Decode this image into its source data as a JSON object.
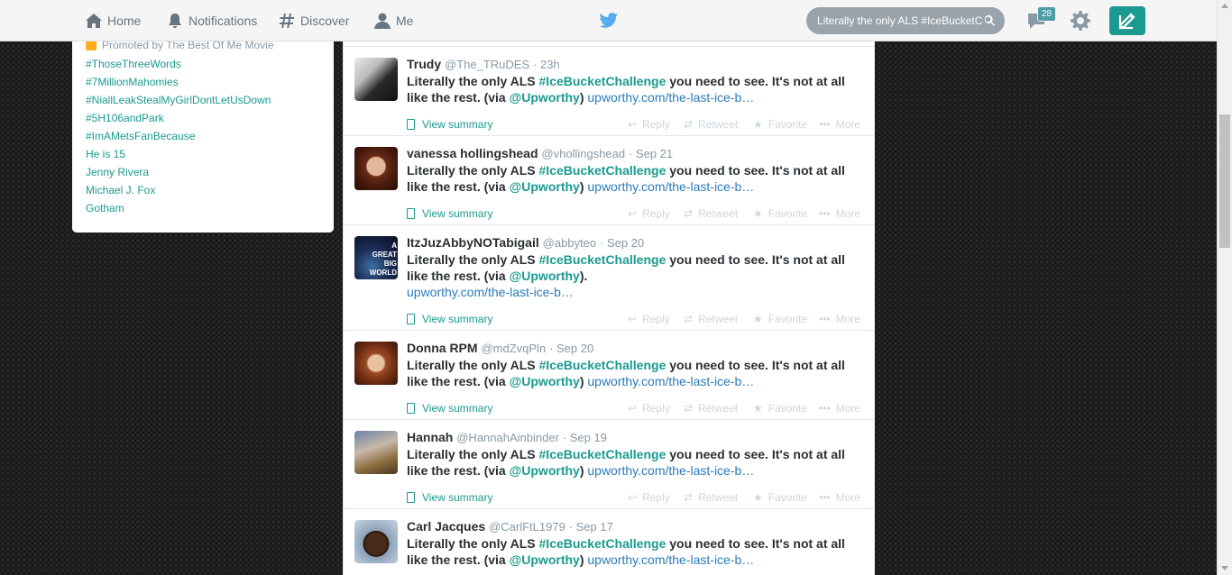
{
  "nav": {
    "home": "Home",
    "notifications": "Notifications",
    "discover": "Discover",
    "me": "Me"
  },
  "search": {
    "value": "Literally the only ALS #IceBucketC"
  },
  "dm_badge": "28",
  "colors": {
    "accent": "#1b9a8f",
    "topbar": "#f5f5f5",
    "bird": "#55acee"
  },
  "trends": {
    "promoted": "Promoted by The Best Of Me Movie",
    "items": [
      "#ThoseThreeWords",
      "#7MillionMahomies",
      "#NiallLeakStealMyGirlDontLetUsDown",
      "#5H106andPark",
      "#ImAMetsFanBecause",
      "He is 15",
      "Jenny Rivera",
      "Michael J. Fox",
      "Gotham"
    ]
  },
  "actions": {
    "summary": "View summary",
    "reply": "Reply",
    "retweet": "Retweet",
    "favorite": "Favorite",
    "more": "More"
  },
  "tweet_text": {
    "pre": "Literally the only ALS ",
    "hashtag": "#IceBucketChallenge",
    "mid": " you need to see. It's not at all like the rest. (via ",
    "mention": "@Upworthy",
    "post": ") ",
    "post_alt": ").",
    "url": "upworthy.com/the-last-ice-b…"
  },
  "tweets": [
    {
      "name": "Trudy",
      "handle": "@The_TRuDES",
      "time": "· 23h"
    },
    {
      "name": "vanessa hollingshead",
      "handle": "@vhollingshead",
      "time": "· Sep 21"
    },
    {
      "name": "ItzJuzAbbyNOTabigail",
      "handle": "@abbyteo",
      "time": "· Sep 20"
    },
    {
      "name": "Donna RPM",
      "handle": "@mdZvqPln",
      "time": "· Sep 20"
    },
    {
      "name": "Hannah",
      "handle": "@HannahAinbinder",
      "time": "· Sep 19"
    },
    {
      "name": "Carl Jacques",
      "handle": "@CarlFtL1979",
      "time": "· Sep 17"
    }
  ],
  "avatar3_text": "A GREAT BIG WORLD"
}
